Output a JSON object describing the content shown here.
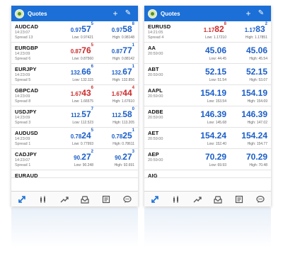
{
  "screens": [
    {
      "title": "Quotes",
      "quotes": [
        {
          "symbol": "AUDCAD",
          "time": "14:23:07",
          "spread": "Spread 13",
          "bid": {
            "base": "0.97",
            "big": "57",
            "sup": "5",
            "color": "blue"
          },
          "ask": {
            "base": "0.97",
            "big": "58",
            "sup": "8",
            "color": "blue"
          },
          "low": "Low: 0.97421",
          "high": "High: 0.98148"
        },
        {
          "symbol": "EURGBP",
          "time": "14:23:09",
          "spread": "Spread 6",
          "bid": {
            "base": "0.87",
            "big": "76",
            "sup": "5",
            "color": "red"
          },
          "ask": {
            "base": "0.87",
            "big": "77",
            "sup": "1",
            "color": "blue"
          },
          "low": "Low: 0.87560",
          "high": "High: 0.88142"
        },
        {
          "symbol": "EURJPY",
          "time": "14:23:09",
          "spread": "Spread 5",
          "bid": {
            "base": "132.",
            "big": "66",
            "sup": "6",
            "color": "blue"
          },
          "ask": {
            "base": "132.",
            "big": "67",
            "sup": "1",
            "color": "blue"
          },
          "low": "Low: 132.115",
          "high": "High: 132.856"
        },
        {
          "symbol": "GBPCAD",
          "time": "14:23:09",
          "spread": "Spread 8",
          "bid": {
            "base": "1.67",
            "big": "43",
            "sup": "6",
            "color": "red"
          },
          "ask": {
            "base": "1.67",
            "big": "44",
            "sup": "4",
            "color": "red"
          },
          "low": "Low: 1.66575",
          "high": "High: 1.67610"
        },
        {
          "symbol": "USDJPY",
          "time": "14:23:09",
          "spread": "Spread 3",
          "bid": {
            "base": "112.",
            "big": "57",
            "sup": "7",
            "color": "blue"
          },
          "ask": {
            "base": "112.",
            "big": "58",
            "sup": "0",
            "color": "blue"
          },
          "low": "Low: 112.523",
          "high": "High: 113.205"
        },
        {
          "symbol": "AUDUSD",
          "time": "14:23:09",
          "spread": "Spread 1",
          "bid": {
            "base": "0.78",
            "big": "24",
            "sup": "5",
            "color": "blue"
          },
          "ask": {
            "base": "0.78",
            "big": "25",
            "sup": "1",
            "color": "blue"
          },
          "low": "Low: 0.77993",
          "high": "High: 0.78611"
        },
        {
          "symbol": "CADJPY",
          "time": "14:23:07",
          "spread": "Spread 1",
          "bid": {
            "base": "90.",
            "big": "27",
            "sup": "2",
            "color": "blue"
          },
          "ask": {
            "base": "90.",
            "big": "27",
            "sup": "3",
            "color": "blue"
          },
          "low": "Low: 90.248",
          "high": "High: 92.691"
        }
      ],
      "partial_symbol": "EURAUD"
    },
    {
      "title": "Quotes",
      "quotes": [
        {
          "symbol": "EURUSD",
          "time": "14:21:05",
          "spread": "Spread 4",
          "bid": {
            "base": "1.17",
            "big": "82",
            "sup": "8",
            "color": "red"
          },
          "ask": {
            "base": "1.17",
            "big": "83",
            "sup": "2",
            "color": "blue"
          },
          "low": "Low: 1.17210",
          "high": "High: 1.17851"
        },
        {
          "symbol": "AA",
          "time": "20:59:00",
          "spread": "",
          "bid": {
            "base": "",
            "big": "45.06",
            "sup": "",
            "color": "blue"
          },
          "ask": {
            "base": "",
            "big": "45.06",
            "sup": "",
            "color": "blue"
          },
          "low": "Low: 44.45",
          "high": "High: 45.54"
        },
        {
          "symbol": "ABT",
          "time": "20:59:00",
          "spread": "",
          "bid": {
            "base": "",
            "big": "52.15",
            "sup": "",
            "color": "blue"
          },
          "ask": {
            "base": "",
            "big": "52.15",
            "sup": "",
            "color": "blue"
          },
          "low": "Low: 51.54",
          "high": "High: 53.07"
        },
        {
          "symbol": "AAPL",
          "time": "20:59:00",
          "spread": "",
          "bid": {
            "base": "",
            "big": "154.19",
            "sup": "",
            "color": "blue"
          },
          "ask": {
            "base": "",
            "big": "154.19",
            "sup": "",
            "color": "blue"
          },
          "low": "Low: 153.54",
          "high": "High: 154.69"
        },
        {
          "symbol": "ADBE",
          "time": "20:59:00",
          "spread": "",
          "bid": {
            "base": "",
            "big": "146.39",
            "sup": "",
            "color": "blue"
          },
          "ask": {
            "base": "",
            "big": "146.39",
            "sup": "",
            "color": "blue"
          },
          "low": "Low: 145.68",
          "high": "High: 147.02"
        },
        {
          "symbol": "AET",
          "time": "20:59:00",
          "spread": "",
          "bid": {
            "base": "",
            "big": "154.24",
            "sup": "",
            "color": "blue"
          },
          "ask": {
            "base": "",
            "big": "154.24",
            "sup": "",
            "color": "blue"
          },
          "low": "Low: 152.40",
          "high": "High: 154.77"
        },
        {
          "symbol": "AEP",
          "time": "20:59:00",
          "spread": "",
          "bid": {
            "base": "",
            "big": "70.29",
            "sup": "",
            "color": "blue"
          },
          "ask": {
            "base": "",
            "big": "70.29",
            "sup": "",
            "color": "blue"
          },
          "low": "Low: 69.93",
          "high": "High: 70.48"
        }
      ],
      "partial_symbol": "AIG"
    }
  ],
  "tabs": [
    "quotes-icon",
    "chart-icon",
    "trade-icon",
    "history-icon",
    "news-icon",
    "chat-icon"
  ],
  "colors": {
    "appbar": "#1b6fd6",
    "blue": "#1a5ec9",
    "red": "#cc2a2a"
  }
}
